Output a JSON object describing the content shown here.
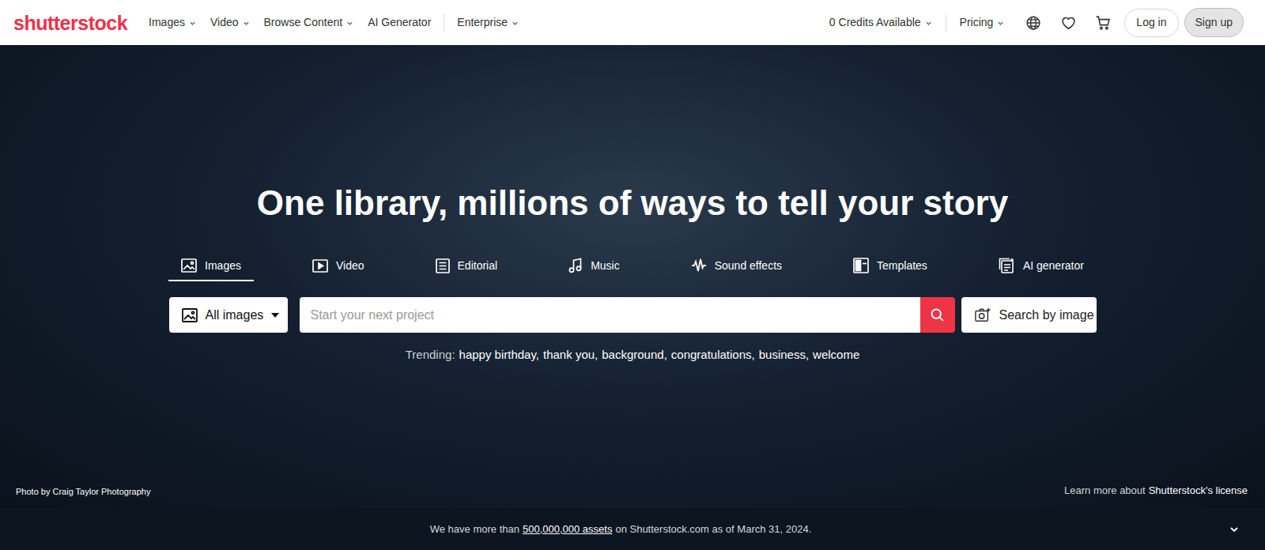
{
  "logo": "shutterstock",
  "nav": [
    {
      "label": "Images",
      "dropdown": true
    },
    {
      "label": "Video",
      "dropdown": true
    },
    {
      "label": "Browse Content",
      "dropdown": true
    },
    {
      "label": "AI Generator",
      "dropdown": false
    },
    {
      "label": "Enterprise",
      "dropdown": true
    }
  ],
  "utility": [
    {
      "label": "0 Credits Available",
      "dropdown": true
    },
    {
      "label": "Pricing",
      "dropdown": true
    }
  ],
  "buttons": {
    "login": "Log in",
    "signup": "Sign up"
  },
  "hero": {
    "heading": "One library, millions of ways to tell your story",
    "tabs": [
      {
        "label": "Images",
        "selected": true
      },
      {
        "label": "Video",
        "selected": false
      },
      {
        "label": "Editorial",
        "selected": false
      },
      {
        "label": "Music",
        "selected": false
      },
      {
        "label": "Sound effects",
        "selected": false
      },
      {
        "label": "Templates",
        "selected": false
      },
      {
        "label": "AI generator",
        "selected": false
      }
    ],
    "search": {
      "category": "All images",
      "placeholder": "Start your next project",
      "image_search": "Search by image"
    },
    "trending": {
      "label": "Trending:",
      "items": [
        "happy birthday,",
        "thank you,",
        "background,",
        "congratulations,",
        "business,",
        "welcome"
      ]
    },
    "photo_credit": "Photo by Craig Taylor Photography",
    "license": {
      "text": "Learn more about",
      "link": "Shutterstock's license"
    }
  },
  "banner": {
    "before": "We have more than",
    "link": "500,000,000 assets",
    "after": "on Shutterstock.com as of March 31, 2024."
  }
}
